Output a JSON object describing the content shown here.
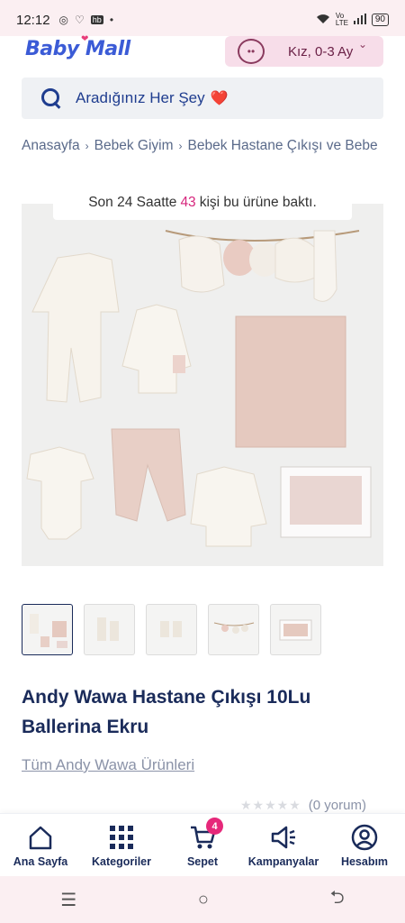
{
  "status_bar": {
    "time": "12:12",
    "left_icons": [
      "whatsapp-icon",
      "heart-app-icon",
      "hb-icon",
      "dot-icon"
    ],
    "hb_label": "hb",
    "network": "Vo LTE",
    "battery": "90"
  },
  "header": {
    "logo_text": "Baby Mall",
    "profile_text": "Kız, 0-3 Ay"
  },
  "search": {
    "placeholder": "Aradığınız Her Şey",
    "emoji": "❤️"
  },
  "breadcrumb": {
    "items": [
      "Anasayfa",
      "Bebek Giyim",
      "Bebek Hastane Çıkışı ve Bebe"
    ]
  },
  "views_banner": {
    "prefix": "Son 24 Saatte",
    "count": "43",
    "suffix": "kişi bu ürüne baktı."
  },
  "product": {
    "title": "Andy Wawa Hastane Çıkışı 10Lu Ballerina Ekru",
    "brand_link": "Tüm Andy Wawa Ürünleri",
    "rating_stars": 0,
    "review_count": "(0 yorum)",
    "thumbnail_count": 5,
    "active_thumbnail": 0
  },
  "bottom_nav": {
    "items": [
      {
        "label": "Ana Sayfa",
        "icon": "home-icon"
      },
      {
        "label": "Kategoriler",
        "icon": "grid-icon"
      },
      {
        "label": "Sepet",
        "icon": "cart-icon",
        "badge": "4"
      },
      {
        "label": "Kampanyalar",
        "icon": "megaphone-icon"
      },
      {
        "label": "Hesabım",
        "icon": "user-icon"
      }
    ]
  },
  "system_nav": {
    "items": [
      "menu-icon",
      "home-circle-icon",
      "back-icon"
    ]
  },
  "colors": {
    "brand_navy": "#1a2b5a",
    "accent_pink": "#e6287a",
    "search_bg": "#eff1f4",
    "profile_bg": "#f7dde9"
  }
}
